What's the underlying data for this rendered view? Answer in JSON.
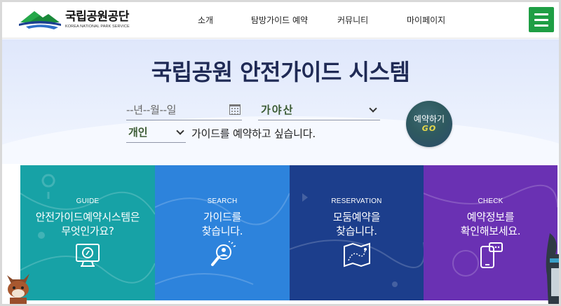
{
  "header": {
    "logo_main": "국립공원공단",
    "logo_sub": "KOREA NATIONAL PARK SERVICE",
    "nav": [
      {
        "label": "소개"
      },
      {
        "label": "탐방가이드 예약"
      },
      {
        "label": "커뮤니티"
      },
      {
        "label": "마이페이지"
      }
    ],
    "menu_icon": "hamburger-menu-icon"
  },
  "hero": {
    "title": "국립공원 안전가이드 시스템",
    "date_placeholder": "--년--월--일",
    "mountain_selected": "가야산",
    "type_selected": "개인",
    "guide_sentence": "가이드를 예약하고 싶습니다.",
    "go_label": "예약하기",
    "go_sub": "GO"
  },
  "cards": [
    {
      "en": "GUIDE",
      "ko": "안전가이드예약시스템은\n무엇인가요?",
      "icon": "tablet-compass-icon",
      "color": "#17a2a6"
    },
    {
      "en": "SEARCH",
      "ko": "가이드를\n찾습니다.",
      "icon": "magnifier-person-icon",
      "color": "#2d83dc"
    },
    {
      "en": "RESERVATION",
      "ko": "모둠예약을\n찾습니다.",
      "icon": "map-route-icon",
      "color": "#1c3e8c"
    },
    {
      "en": "CHECK",
      "ko": "예약정보를\n확인해보세요.",
      "icon": "phone-chat-icon",
      "color": "#6a31b3"
    }
  ],
  "colors": {
    "accent_green": "#1e9e44",
    "title_navy": "#1f2a55"
  }
}
